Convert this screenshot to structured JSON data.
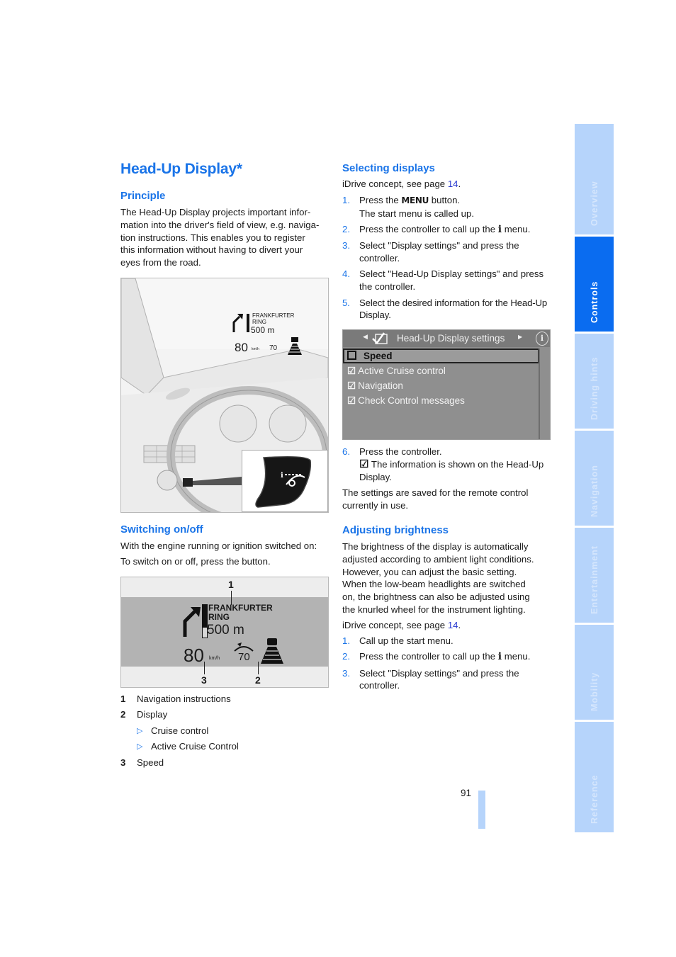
{
  "title": "Head-Up Display*",
  "principle": {
    "heading": "Principle",
    "lines": [
      "The Head-Up Display projects important infor-",
      "mation into the driver's field of view, e.g. naviga-",
      "tion instructions. This enables you to register",
      "this information without having to divert your",
      "eyes from the road."
    ]
  },
  "figure_cockpit": {
    "hud": {
      "street_line1": "FRANKFURTER",
      "street_line2": "RING",
      "distance": "500 m",
      "speed": "80",
      "speed_unit": "km/h",
      "cruise_speed": "70"
    },
    "button_icon": "head-up-display-button-icon"
  },
  "switching": {
    "heading": "Switching on/off",
    "line1": "With the engine running or ignition switched on:",
    "line2": "To switch on or off, press the button."
  },
  "figure_hud": {
    "street_line1": "FRANKFURTER",
    "street_line2": "RING",
    "distance": "500 m",
    "speed": "80",
    "speed_unit": "km/h",
    "cruise_speed": "70",
    "callouts": [
      "1",
      "2",
      "3"
    ]
  },
  "legend": [
    {
      "num": "1",
      "text": "Navigation instructions"
    },
    {
      "num": "2",
      "text": "Display"
    },
    {
      "sub": true,
      "text": "Cruise control"
    },
    {
      "sub": true,
      "text": "Active Cruise Control"
    },
    {
      "num": "3",
      "text": "Speed"
    }
  ],
  "selecting": {
    "heading": "Selecting displays",
    "intro_text": "iDrive concept, see page ",
    "intro_page": "14",
    "intro_end": ".",
    "steps": [
      {
        "num": "1.",
        "pre": "Press the ",
        "key": "MENU",
        "post": " button.",
        "line2": "The start menu is called up."
      },
      {
        "num": "2.",
        "pre": "Press the controller to call up the ",
        "icon": "i",
        "post": " menu."
      },
      {
        "num": "3.",
        "text": "Select \"Display settings\" and press the controller."
      },
      {
        "num": "4.",
        "text": "Select \"Head-Up Display settings\" and press the controller."
      },
      {
        "num": "5.",
        "text": "Select the desired information for the Head-Up Display."
      }
    ],
    "step6": {
      "num": "6.",
      "text": "Press the controller.",
      "note": "The information is shown on the Head-Up Display."
    },
    "saved_note": "The settings are saved for the remote control currently in use."
  },
  "screen": {
    "header": "Head-Up Display settings",
    "items": [
      {
        "label": "Speed",
        "checked": false,
        "selected": true
      },
      {
        "label": "Active Cruise control",
        "checked": true,
        "selected": false
      },
      {
        "label": "Navigation",
        "checked": true,
        "selected": false
      },
      {
        "label": "Check Control messages",
        "checked": true,
        "selected": false
      }
    ]
  },
  "brightness": {
    "heading": "Adjusting brightness",
    "lines": [
      "The brightness of the display is automatically",
      "adjusted according to ambient light conditions.",
      "However, you can adjust the basic setting.",
      "When the low-beam headlights are switched",
      "on, the brightness can also be adjusted using",
      "the knurled wheel for the instrument lighting."
    ],
    "intro_text": "iDrive concept, see page ",
    "intro_page": "14",
    "intro_end": ".",
    "steps": [
      {
        "num": "1.",
        "text": "Call up the start menu."
      },
      {
        "num": "2.",
        "pre": "Press the controller to call up the ",
        "icon": "i",
        "post": " menu."
      },
      {
        "num": "3.",
        "text": "Select \"Display settings\" and press the controller."
      }
    ]
  },
  "page_number": "91",
  "side_tabs": [
    {
      "label": "Overview",
      "active": false
    },
    {
      "label": "Controls",
      "active": true
    },
    {
      "label": "Driving hints",
      "active": false
    },
    {
      "label": "Navigation",
      "active": false
    },
    {
      "label": "Entertainment",
      "active": false
    },
    {
      "label": "Mobility",
      "active": false
    },
    {
      "label": "Reference",
      "active": false
    }
  ],
  "colors": {
    "accent": "#1a74e8",
    "tab_active": "#0a6cf0",
    "tab_inactive": "#b6d4fb",
    "link": "#2a3bd0"
  }
}
